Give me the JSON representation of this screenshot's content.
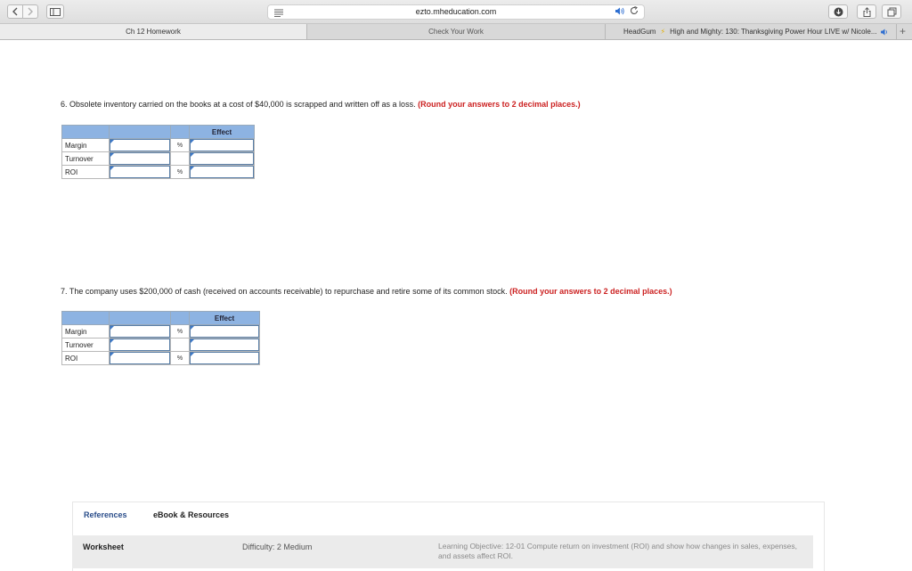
{
  "browser": {
    "url": "ezto.mheducation.com",
    "tabs": [
      {
        "label": "Ch 12 Homework"
      },
      {
        "label": "Check Your Work"
      },
      {
        "label_left": "HeadGum",
        "label_right": "High and Mighty: 130: Thanksgiving Power Hour LIVE w/ Nicole..."
      }
    ],
    "new_tab_label": "+"
  },
  "questions": [
    {
      "prompt": "6. Obsolete inventory carried on the books at a cost of $40,000 is scrapped and written off as a loss.",
      "hint": "(Round your answers to 2 decimal places.)",
      "effect_header": "Effect",
      "rows": [
        {
          "label": "Margin",
          "unit": "%",
          "value": "",
          "effect": ""
        },
        {
          "label": "Turnover",
          "unit": "",
          "value": "",
          "effect": ""
        },
        {
          "label": "ROI",
          "unit": "%",
          "value": "",
          "effect": ""
        }
      ]
    },
    {
      "prompt": "7. The company uses $200,000 of cash (received on accounts receivable) to repurchase and retire some of its common stock.",
      "hint": "(Round your answers to 2 decimal places.)",
      "effect_header": "Effect",
      "rows": [
        {
          "label": "Margin",
          "unit": "%",
          "value": "",
          "effect": ""
        },
        {
          "label": "Turnover",
          "unit": "",
          "value": "",
          "effect": ""
        },
        {
          "label": "ROI",
          "unit": "%",
          "value": "",
          "effect": ""
        }
      ]
    }
  ],
  "references": {
    "tabs": [
      "References",
      "eBook & Resources"
    ],
    "worksheet": "Worksheet",
    "difficulty": "Difficulty: 2 Medium",
    "objective": "Learning Objective: 12-01 Compute return on investment (ROI) and show how changes in sales, expenses, and assets affect ROI."
  },
  "colors": {
    "hint": "#cc2222",
    "table_header": "#8db3e2",
    "references_tab": "#2a4d8a"
  }
}
